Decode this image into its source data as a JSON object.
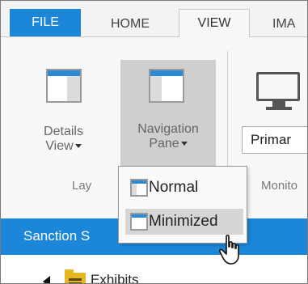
{
  "tabs": {
    "file": "FILE",
    "home": "HOME",
    "view": "VIEW",
    "ima": "IMA"
  },
  "ribbon": {
    "details_view": {
      "label": "Details View",
      "label_line1": "Details",
      "label_line2": "View"
    },
    "navigation_pane": {
      "label_line1": "Navigation",
      "label_line2": "Pane"
    },
    "primary_combo": {
      "value": "Primar"
    },
    "groups": {
      "layout": "Lay",
      "monitor": "Monito"
    }
  },
  "dropdown": {
    "items": [
      {
        "label": "Normal"
      },
      {
        "label": "Minimized"
      }
    ]
  },
  "panel": {
    "title": "Sanction S",
    "tree": [
      {
        "label": "Exhibits"
      }
    ]
  },
  "colors": {
    "accent": "#1c87d8",
    "folder": "#e6b820"
  }
}
